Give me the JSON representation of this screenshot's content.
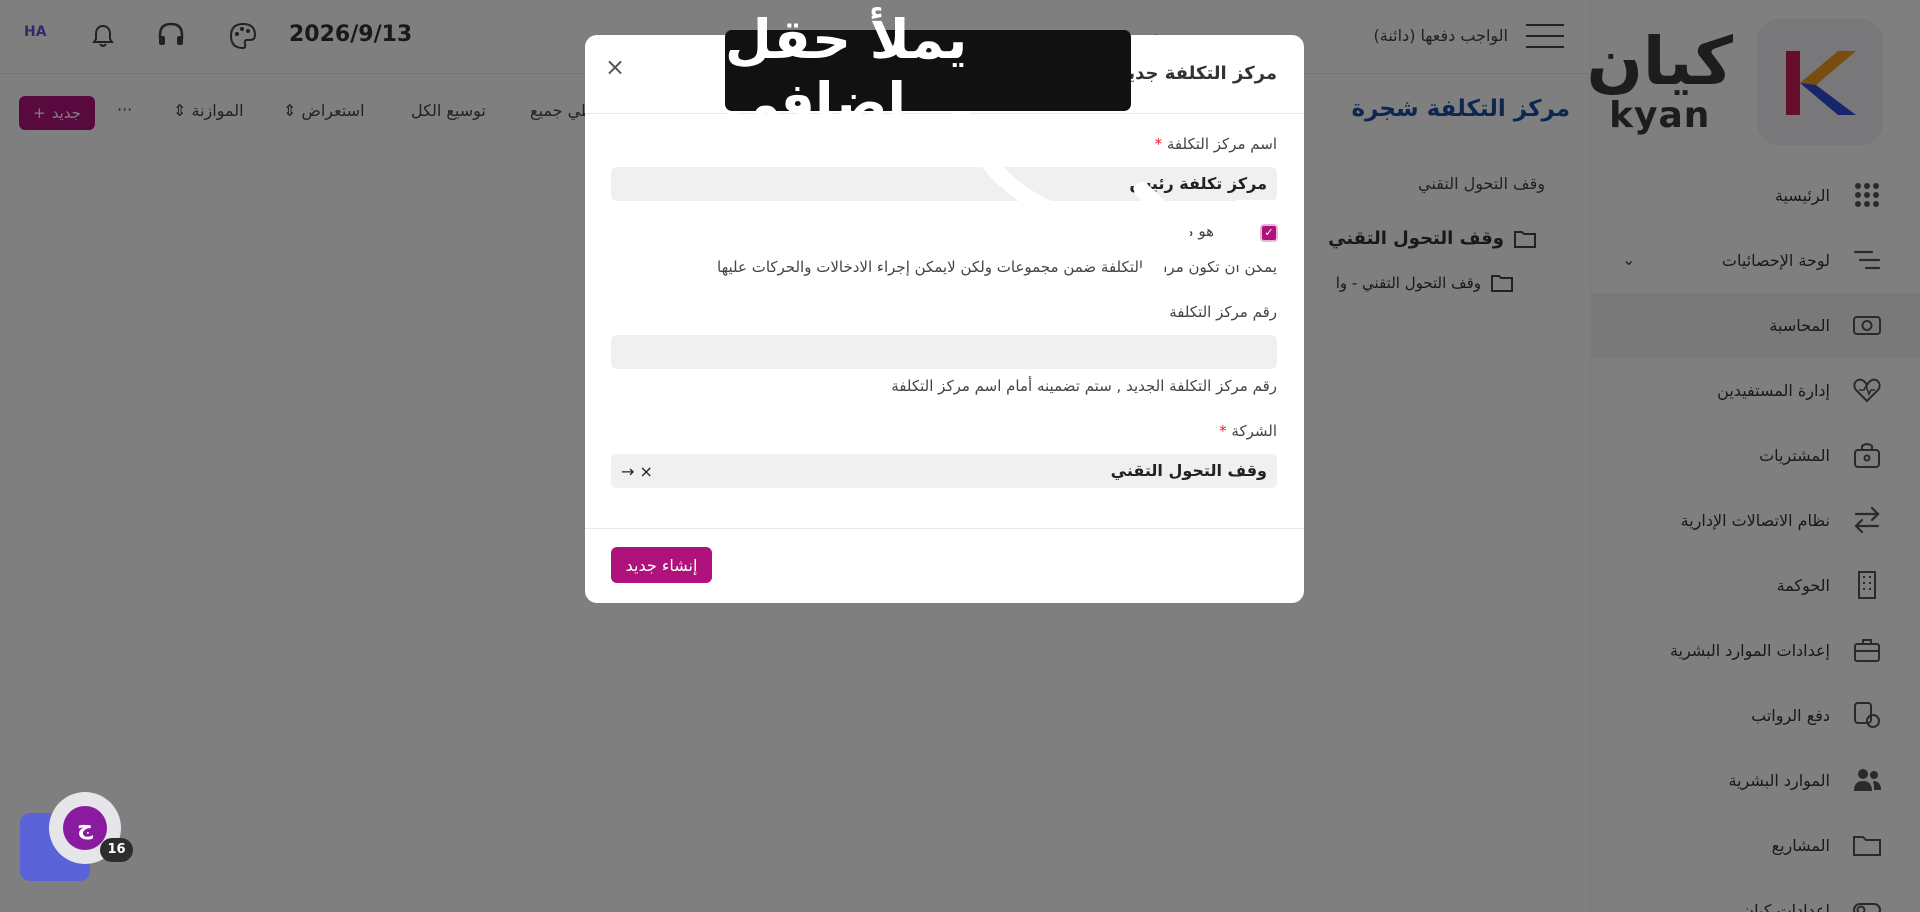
{
  "brand": {
    "name_ar": "كيان",
    "name_en": "kyan"
  },
  "sidebar": {
    "items": [
      {
        "label": "الرئيسية",
        "icon": "dots-grid-icon"
      },
      {
        "label": "لوحة الإحصائيات",
        "icon": "stats-lines-icon"
      },
      {
        "label": "المحاسبة",
        "icon": "money-icon"
      },
      {
        "label": "إدارة المستفيدين",
        "icon": "heart-pulse-icon"
      },
      {
        "label": "المشتريات",
        "icon": "bag-icon"
      },
      {
        "label": "نظام الاتصالات الإدارية",
        "icon": "arrows-swap-icon"
      },
      {
        "label": "الحوكمة",
        "icon": "building-icon"
      },
      {
        "label": "إعدادات الموارد البشرية",
        "icon": "briefcase-icon"
      },
      {
        "label": "دفع الرواتب",
        "icon": "coins-icon"
      },
      {
        "label": "الموارد البشرية",
        "icon": "people-icon"
      },
      {
        "label": "المشاريع",
        "icon": "folder-icon"
      },
      {
        "label": "إعدادات كيان",
        "icon": "toggle-icon"
      }
    ]
  },
  "topbar": {
    "breadcrumb": "الواجب دفعها (دائنة)",
    "date": "2026/9/13",
    "avatar_initials": "HA"
  },
  "toolbar": {
    "new_label": "جديد",
    "more_label": "···",
    "comparison_label": "الموازنة",
    "browse_label": "استعراض",
    "expand_all_label": "توسيع الكل",
    "collapse_all_label": "طي جميع"
  },
  "page": {
    "title": "مركز التكلفة شجرة",
    "company_filter": "وقف التحول التقني",
    "tree_root": "وقف التحول التقني",
    "tree_child": "وقف التحول التقني - وا"
  },
  "modal": {
    "title": "مركز التكلفة جديد",
    "name_label": "اسم مركز التكلفة",
    "name_value": "مركز تكلفة رئيس",
    "is_group_label": "هو مجموعة",
    "is_group_checked": true,
    "is_group_help": "يمكن أن تكون مراكز التكلفة ضمن مجموعات ولكن لايمكن إجراء الادخالات والحركات عليها",
    "number_label": "رقم مركز التكلفة",
    "number_value": "",
    "number_help": "رقم مركز التكلفة الجديد , ستم تضمينه أمام اسم مركز التكلفة",
    "company_label": "الشركة",
    "company_value": "وقف التحول التقني",
    "create_label": "إنشاء جديد"
  },
  "annotation": {
    "text": "يملأ حقل إضافي"
  },
  "chat": {
    "badge_count": "16"
  },
  "colors": {
    "accent": "#b0127c",
    "link": "#1e4fa0",
    "chat": "#5b63d9"
  }
}
